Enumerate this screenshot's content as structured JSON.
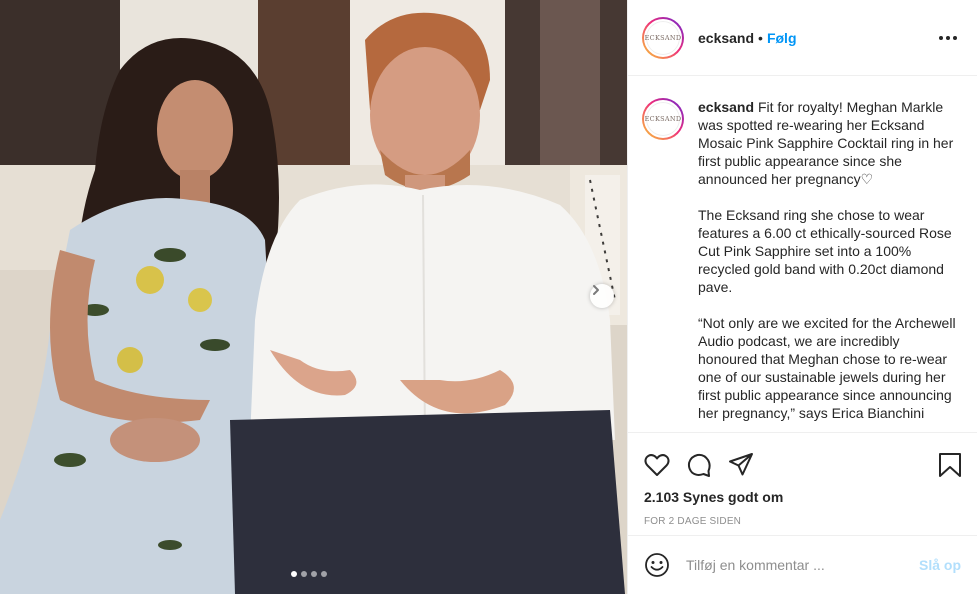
{
  "post": {
    "photo_alt": "Photo",
    "carousel": {
      "total": 4,
      "active": 0
    },
    "next_icon": "chevron-right-icon"
  },
  "header": {
    "avatar_text": "ECKSAND",
    "username": "ecksand",
    "separator": "•",
    "follow_label": "Følg",
    "more_icon": "more-options-icon"
  },
  "caption": {
    "avatar_text": "ECKSAND",
    "username": "ecksand",
    "paragraph_1": "Fit for royalty! Meghan Markle was spotted re-wearing her Ecksand Mosaic Pink Sapphire Cocktail ring in her first public appearance since she announced her pregnancy♡",
    "paragraph_2": "The Ecksand ring she chose to wear features a 6.00 ct ethically-sourced Rose Cut Pink Sapphire set into a 100% recycled gold band with 0.20ct diamond pave.",
    "paragraph_3": "“Not only are we excited for the Archewell Audio podcast, we are incredibly honoured that Meghan chose to re-wear one of our sustainable jewels during her first public appearance since announcing her pregnancy,” says Erica Bianchini"
  },
  "actions": {
    "like_icon": "heart-icon",
    "comment_icon": "comment-icon",
    "share_icon": "send-icon",
    "save_icon": "bookmark-icon"
  },
  "likes_text": "2.103 Synes godt om",
  "timestamp": "FOR 2 DAGE SIDEN",
  "comment": {
    "emoji_icon": "emoji-icon",
    "placeholder": "Tilføj en kommentar ...",
    "post_label": "Slå op"
  },
  "colors": {
    "link_blue": "#0095f6",
    "post_disabled": "#b2dffc",
    "border": "#efefef"
  }
}
